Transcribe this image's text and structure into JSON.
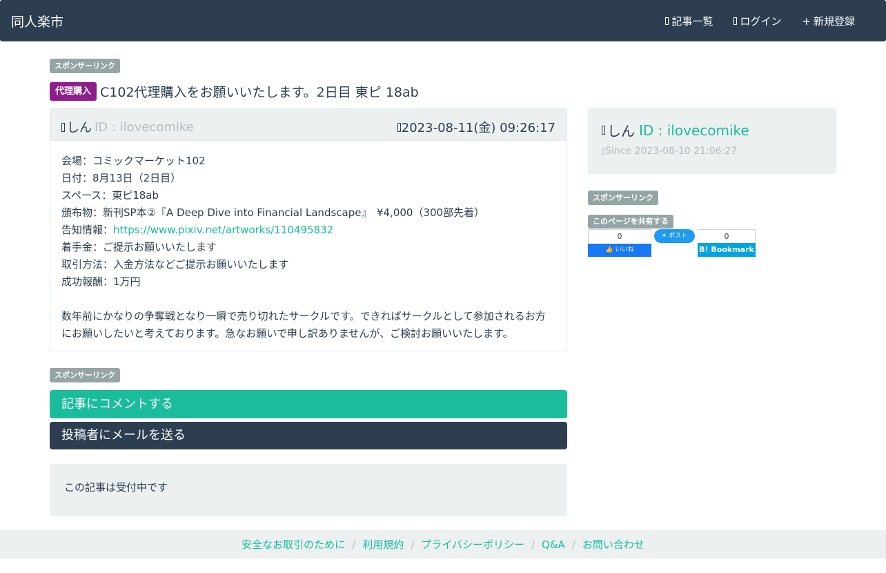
{
  "navbar": {
    "brand": "同人楽市",
    "links": [
      {
        "label": "記事一覧",
        "icon": "list-icon"
      },
      {
        "label": "ログイン",
        "icon": "login-icon"
      },
      {
        "label": "新規登録",
        "icon": "plus-icon"
      }
    ]
  },
  "sponsor_label": "スポンサーリンク",
  "share_label": "このページを共有する",
  "article": {
    "category": "代理購入",
    "title": "C102代理購入をお願いいたします。2日目 東ピ 18ab",
    "author_name": "しん",
    "author_id": "ID : ilovecomike",
    "posted_at": "2023-08-11(金) 09:26:17",
    "lines": [
      "会場：コミックマーケット102",
      "日付：8月13日（2日目）",
      "スペース：東ピ18ab",
      "頒布物：新刊SP本②『A Deep Dive into Financial Landscape』　¥4,000（300部先着）"
    ],
    "info_label": "告知情報：",
    "info_link": "https://www.pixiv.net/artworks/110495832",
    "lines2": [
      "着手金：ご提示お願いいたします",
      "取引方法：入金方法などご提示お願いいたします",
      "成功報酬：1万円"
    ],
    "note": "数年前にかなりの争奪戦となり一瞬で売り切れたサークルです。できればサークルとして参加されるお方にお願いしたいと考えております。急なお願いで申し訳ありませんが、ご検討お願いいたします。"
  },
  "buttons": {
    "comment": "記事にコメントする",
    "mail": "投稿者にメールを送る"
  },
  "status": "この記事は受付中です",
  "profile": {
    "name": "しん",
    "id": "ID : ilovecomike",
    "since": "Since 2023-08-10 21:06:27"
  },
  "share": {
    "fb_count": "0",
    "fb_label": "いいね",
    "tw_label": "ポスト",
    "hb_count": "0",
    "hb_label": "B! Bookmark"
  },
  "footer": {
    "links": [
      "安全なお取引のために",
      "利用規約",
      "プライバシーポリシー",
      "Q&A",
      "お問い合わせ"
    ],
    "separator": "/"
  },
  "colors": {
    "primary": "#2c3e50",
    "success": "#18bc9c",
    "light": "#ecf0f1",
    "muted": "#95a5a6",
    "category": "#8e1f8a"
  }
}
